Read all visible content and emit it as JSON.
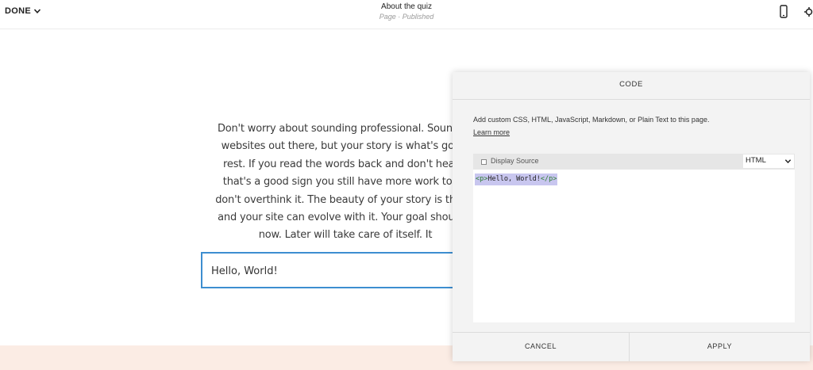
{
  "header": {
    "done_label": "DONE",
    "page_title": "About the quiz",
    "page_status": "Page · Published"
  },
  "content": {
    "paragraph_lines": [
      "Don't worry about sounding professional. Sound lik",
      "websites out there, but your story is what's going",
      "rest. If you read the words back and don't hear y",
      "that's a good sign you still have more work to do",
      "don't overthink it. The beauty of your story is that it",
      "and your site can evolve with it. Your goal should b",
      "now. Later will take care of itself. It"
    ],
    "textbox_value": "Hello, World!"
  },
  "code_panel": {
    "title": "CODE",
    "description": "Add custom CSS, HTML, JavaScript, Markdown, or Plain Text to this page.",
    "learn_more": "Learn more",
    "display_source_label": "Display Source",
    "language_selected": "HTML",
    "code": {
      "open_tag": "<p>",
      "text": "Hello, World!",
      "close_tag": "</p>"
    },
    "cancel_label": "CANCEL",
    "apply_label": "APPLY"
  },
  "colors": {
    "accent_border": "#3d8ed0",
    "footer_band": "#fbece4",
    "code_highlight": "#c8c6ef",
    "tag_color": "#2e7d32"
  },
  "icons": [
    "chevron-down-icon",
    "mobile-icon",
    "gear-icon"
  ]
}
